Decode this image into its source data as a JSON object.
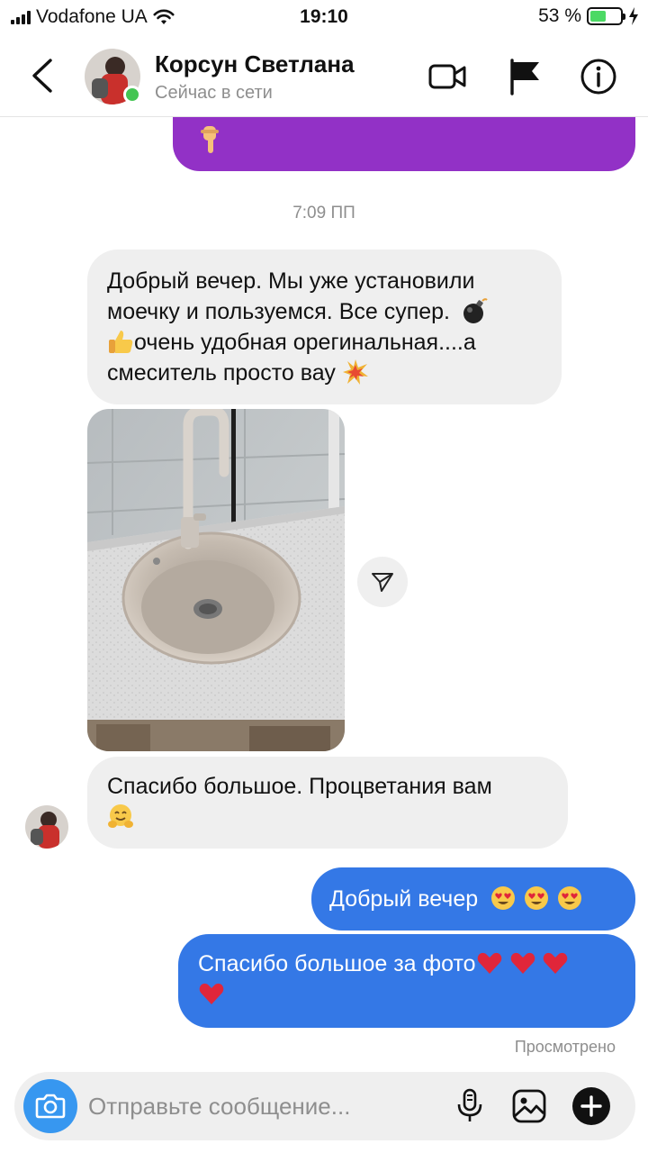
{
  "status_bar": {
    "carrier": "Vodafone UA",
    "time": "19:10",
    "battery_text": "53 %",
    "battery_level": 0.53,
    "battery_color": "#4cd964"
  },
  "header": {
    "contact_name": "Корсун Светлана",
    "status_text": "Сейчас в сети",
    "icons": [
      "back-chevron-icon",
      "video-call-icon",
      "flag-icon",
      "info-icon"
    ]
  },
  "timestamp": "7:09 ПП",
  "messages": {
    "incoming_1": {
      "line1": "Добрый вечер. Мы уже установили",
      "line2": "моечку и пользуемся. Все супер.",
      "line3": "очень удобная орегинальная....а",
      "line4": "смеситель просто вау"
    },
    "incoming_3": {
      "line1": "Спасибо большое. Процветания вам"
    },
    "outgoing_1": {
      "text": "Добрый вечер"
    },
    "outgoing_2": {
      "text": "Спасибо большое за фото"
    }
  },
  "seen_label": "Просмотрено",
  "composer": {
    "placeholder": "Отправьте сообщение...",
    "icons": [
      "camera-icon",
      "microphone-icon",
      "gallery-icon",
      "plus-icon"
    ]
  },
  "colors": {
    "outgoing_bubble": "#3478e6",
    "incoming_bubble": "#efefef",
    "previous_message_bubble": "#9231c6",
    "camera_button": "#3797f0",
    "online_dot": "#44c553"
  }
}
